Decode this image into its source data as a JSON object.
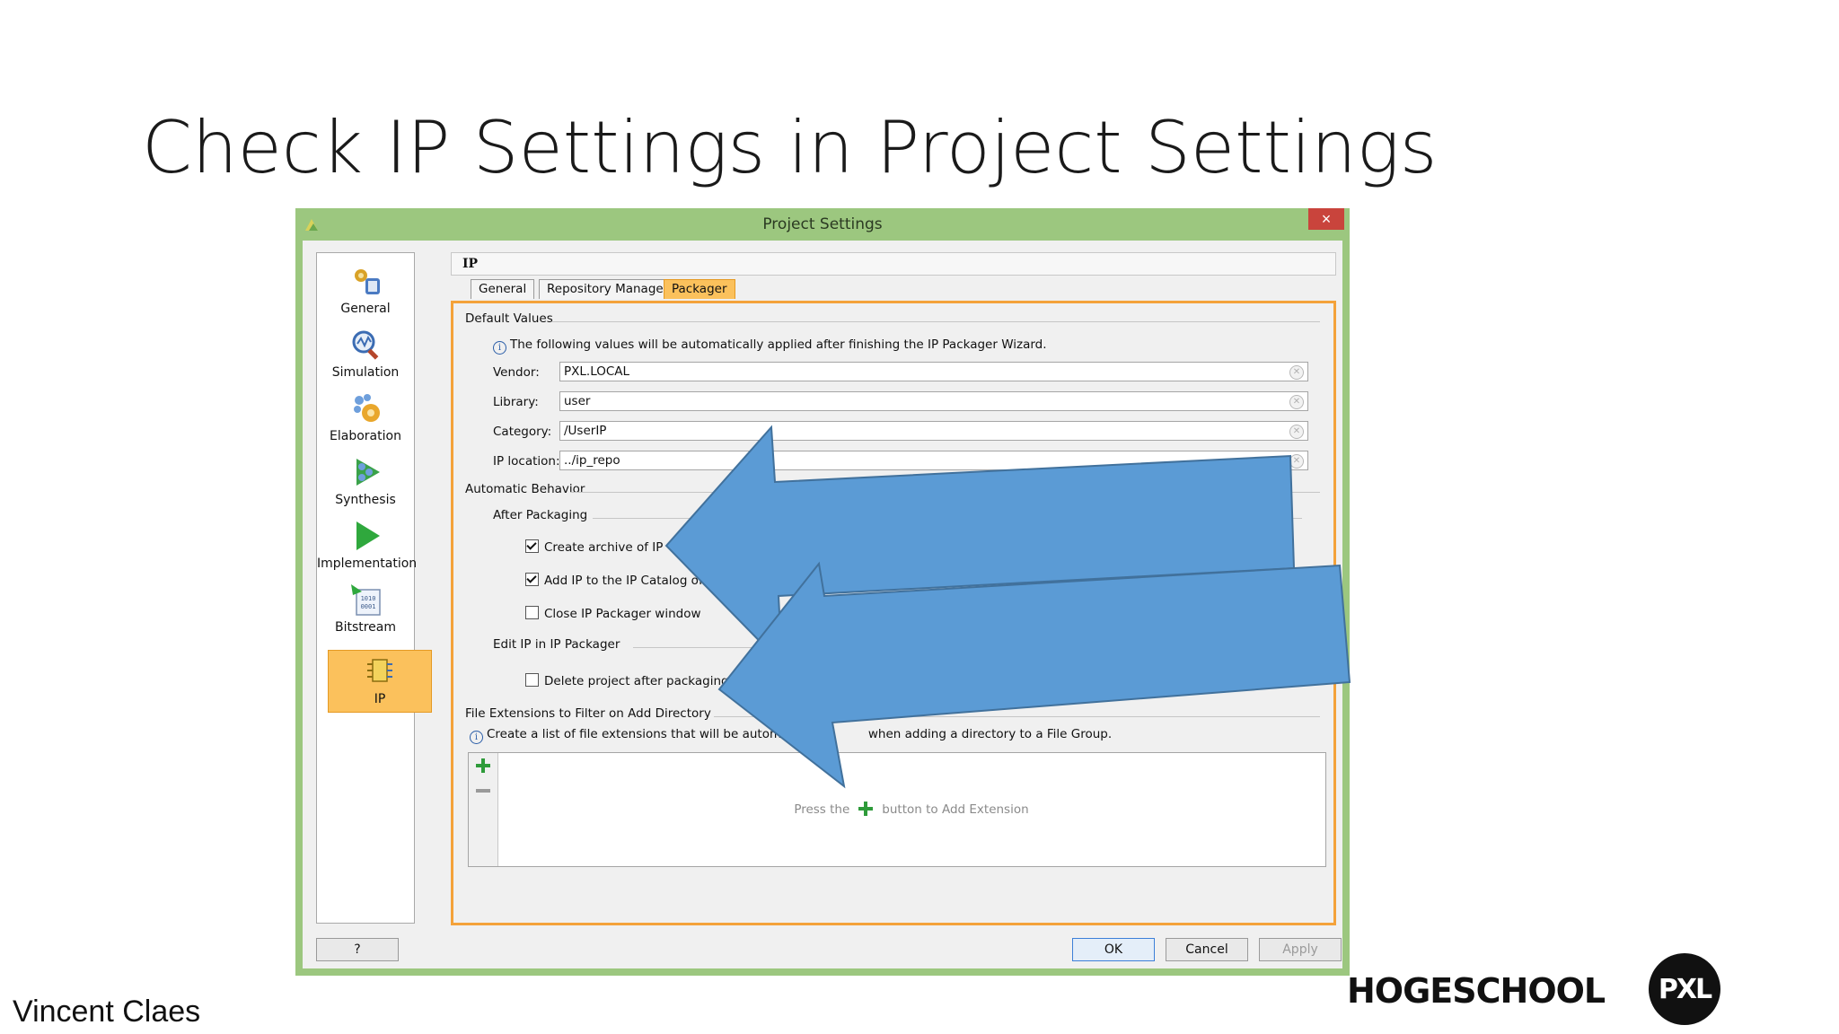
{
  "slide": {
    "title": "Check IP Settings in Project Settings",
    "author": "Vincent Claes",
    "logo_text": "HOGESCHOOL",
    "logo_badge": "PXL"
  },
  "dialog": {
    "title": "Project Settings",
    "close_label": "×",
    "nav": [
      {
        "label": "General",
        "icon": "general-icon"
      },
      {
        "label": "Simulation",
        "icon": "simulation-icon"
      },
      {
        "label": "Elaboration",
        "icon": "elaboration-icon"
      },
      {
        "label": "Synthesis",
        "icon": "synthesis-icon"
      },
      {
        "label": "Implementation",
        "icon": "implementation-icon"
      },
      {
        "label": "Bitstream",
        "icon": "bitstream-icon"
      },
      {
        "label": "IP",
        "icon": "ip-icon",
        "selected": true
      }
    ],
    "panel_title": "IP",
    "tabs": [
      {
        "label": "General"
      },
      {
        "label": "Repository Manager"
      },
      {
        "label": "Packager",
        "active": true
      }
    ],
    "default_values": {
      "title": "Default Values",
      "info": "The following values will be automatically applied after finishing the IP Packager Wizard.",
      "vendor_label": "Vendor:",
      "vendor_value": "PXL.LOCAL",
      "library_label": "Library:",
      "library_value": "user",
      "category_label": "Category:",
      "category_value": "/UserIP",
      "ip_location_label": "IP location:",
      "ip_location_value": "../ip_repo"
    },
    "automatic_behavior": {
      "title": "Automatic Behavior",
      "after_packaging_title": "After Packaging",
      "create_archive_label": "Create archive of IP",
      "create_archive_checked": true,
      "add_ip_label": "Add IP to the IP Catalog of",
      "add_ip_checked": true,
      "close_packager_label": "Close IP Packager window",
      "close_packager_checked": false,
      "edit_ip_title": "Edit IP in IP Packager",
      "delete_project_label": "Delete project after packaging",
      "delete_project_checked": false
    },
    "file_extensions": {
      "title": "File Extensions to Filter on Add Directory",
      "info_start": "Create a list of file extensions that will be automatical",
      "info_end": "when adding a directory to a File Group.",
      "hint_before": "Press the",
      "hint_after": "button to Add Extension"
    },
    "buttons": {
      "help": "?",
      "ok": "OK",
      "cancel": "Cancel",
      "apply": "Apply"
    }
  },
  "colors": {
    "window_frame": "#9cc77f",
    "selected_accent": "#fbc15c",
    "panel_border": "#f4a23a",
    "arrow_fill": "#5b9bd5",
    "arrow_stroke": "#41719c"
  }
}
